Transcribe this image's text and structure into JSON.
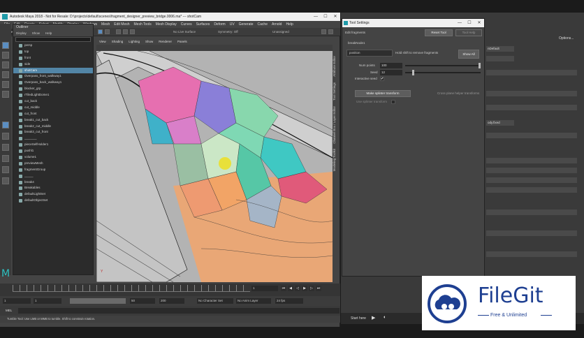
{
  "maya": {
    "title": "Autodesk Maya 2018 - Not for Resale: D:\\projects\\default\\scenes\\fragment_designer_preview_bridge.0006.ma* --- shotCam",
    "menus": [
      "File",
      "Edit",
      "Create",
      "Select",
      "Modify",
      "Display",
      "Windows",
      "Mesh",
      "Edit Mesh",
      "Mesh Tools",
      "Mesh Display",
      "Curves",
      "Surfaces",
      "Deform",
      "UV",
      "Generate",
      "Cache",
      "Arnold",
      "Help"
    ],
    "mode": "Modeling",
    "no_live_surface": "No Live Surface",
    "symmetry": "Symmetry: Off",
    "camera_set": "Unassigned"
  },
  "outliner": {
    "title": "Outliner",
    "menus": [
      "Display",
      "Show",
      "Help"
    ],
    "items": [
      "persp",
      "top",
      "front",
      "side",
      "shotCam",
      "Overpass_front_walkway1",
      "Overpass_back_walkway1",
      "blocker_grp",
      "rTiledLightDome1",
      "cut_back",
      "cut_middle",
      "cut_front",
      "break1_cut_back",
      "break2_cut_middle",
      "break3_cut_front",
      "_______",
      "pieceSelfHolder1",
      "pushl1",
      "volume1",
      "previewMesh",
      "fragmentGroup",
      "_____",
      "break4",
      "Breakables",
      "defaultLightSet",
      "defaultObjectSet"
    ],
    "selected_index": 4
  },
  "viewport": {
    "menus": [
      "View",
      "Shading",
      "Lighting",
      "Show",
      "Renderer",
      "Panels"
    ],
    "axis": "Y"
  },
  "timeline": {
    "current_frame": "1",
    "start": "1",
    "range_start": "1",
    "range_end": "50",
    "end": "200",
    "char_set": "No Character Set",
    "anim_layer": "No Anim Layer",
    "fps": "24 fps",
    "cmd_label": "MEL",
    "help": "Tumble Tool: Use LMB or MMB to tumble. Shift to constrain rotation."
  },
  "tool_settings": {
    "title": "Tool Settings",
    "header": "Edit fragments",
    "reset_button": "Reset Tool",
    "help_button": "Tool Help",
    "node_name": "breakNode1",
    "position_mode": "position",
    "hold_hint": "Hold shift to remove fragments",
    "show_all_button": "Show All",
    "num_points_label": "Num points",
    "num_points_value": "100",
    "seed_label": "Seed",
    "seed_value": "12",
    "interactive_label": "Interactive seed",
    "interactive_checked": "✔",
    "splinter_button": "Make splinter transform",
    "cross_hint": "Cross plane helper transforms",
    "use_splinter": "Use splinter transform"
  },
  "side_tabs": [
    "Attribute Editor",
    "Tool Settings",
    "Channel Box / Layer Editor",
    "Modeling Toolkit"
  ],
  "right": {
    "options": "Options...",
    "field1": "nDefault",
    "field2": "ody.fixed"
  },
  "taskbar": {
    "start_here": "Start here"
  },
  "watermark": {
    "brand": "FileGit",
    "tagline": "Free & Unlimited"
  }
}
